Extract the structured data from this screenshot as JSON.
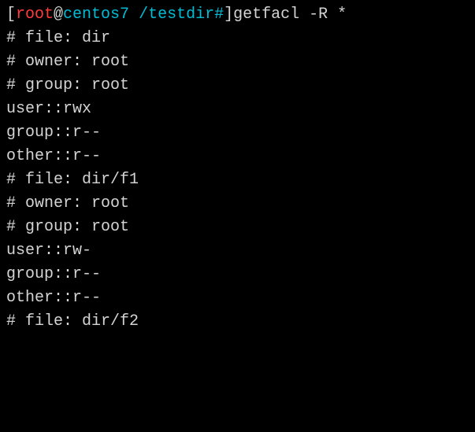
{
  "prompt": {
    "open_bracket": "[",
    "user": "root",
    "at": "@",
    "host": "centos7 ",
    "path": "/testdir#",
    "close_bracket": "]",
    "command": "getfacl -R *"
  },
  "output": {
    "line1": "# file: dir",
    "line2": "# owner: root",
    "line3": "# group: root",
    "line4": "user::rwx",
    "line5": "group::r--",
    "line6": "other::r--",
    "line7": "",
    "line8": "# file: dir/f1",
    "line9": "# owner: root",
    "line10": "# group: root",
    "line11": "user::rw-",
    "line12": "group::r--",
    "line13": "other::r--",
    "line14": "",
    "line15": "# file: dir/f2"
  }
}
